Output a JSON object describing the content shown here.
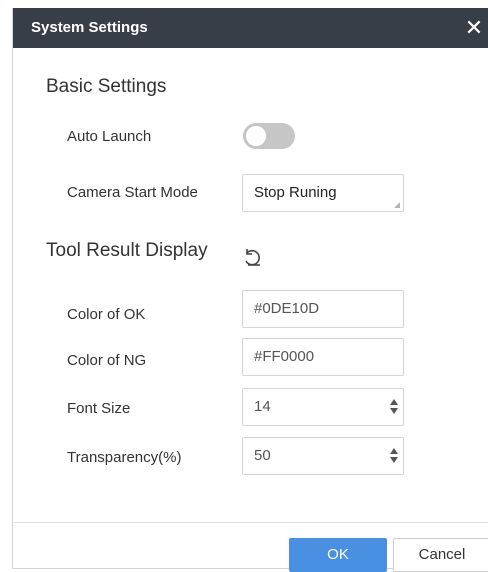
{
  "dialog": {
    "title": "System Settings",
    "close_icon": "close-icon"
  },
  "basic_settings": {
    "heading": "Basic Settings",
    "auto_launch": {
      "label": "Auto Launch",
      "enabled": false
    },
    "camera_start_mode": {
      "label": "Camera Start Mode",
      "value": "Stop Runing"
    }
  },
  "tool_result_display": {
    "heading": "Tool Result Display",
    "reset_icon": "reset-icon",
    "color_ok": {
      "label": "Color of OK",
      "value": "#0DE10D"
    },
    "color_ng": {
      "label": "Color of NG",
      "value": "#FF0000"
    },
    "font_size": {
      "label": "Font Size",
      "value": "14"
    },
    "transparency": {
      "label": "Transparency(%)",
      "value": "50"
    }
  },
  "footer": {
    "ok_label": "OK",
    "cancel_label": "Cancel"
  },
  "colors": {
    "titlebar": "#383e48",
    "accent": "#4a90e2",
    "toggle_off": "#c6c6c6"
  }
}
